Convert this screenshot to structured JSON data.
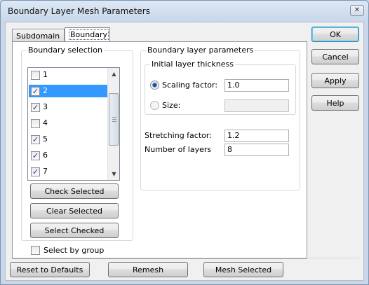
{
  "window": {
    "title": "Boundary Layer Mesh Parameters",
    "close_label": "✕"
  },
  "tabs": [
    {
      "label": "Subdomain",
      "active": false
    },
    {
      "label": "Boundary",
      "active": true
    }
  ],
  "boundary_selection": {
    "title": "Boundary selection",
    "items": [
      {
        "label": "1",
        "checked": false,
        "selected": false
      },
      {
        "label": "2",
        "checked": true,
        "selected": true
      },
      {
        "label": "3",
        "checked": true,
        "selected": false
      },
      {
        "label": "4",
        "checked": false,
        "selected": false
      },
      {
        "label": "5",
        "checked": true,
        "selected": false
      },
      {
        "label": "6",
        "checked": true,
        "selected": false
      },
      {
        "label": "7",
        "checked": true,
        "selected": false
      }
    ],
    "check_selected": "Check Selected",
    "clear_selected": "Clear Selected",
    "select_checked": "Select Checked",
    "select_by_group": "Select by group",
    "select_by_group_checked": false
  },
  "boundary_layer": {
    "title": "Boundary layer parameters",
    "initial_thickness_title": "Initial layer thickness",
    "scaling_factor_label": "Scaling factor:",
    "scaling_factor_value": "1.0",
    "size_label": "Size:",
    "size_value": "",
    "stretching_factor_label": "Stretching factor:",
    "stretching_factor_value": "1.2",
    "num_layers_label": "Number of layers",
    "num_layers_value": "8"
  },
  "side_buttons": {
    "ok": "OK",
    "cancel": "Cancel",
    "apply": "Apply",
    "help": "Help"
  },
  "bottom_buttons": {
    "reset": "Reset to Defaults",
    "remesh": "Remesh",
    "mesh_selected": "Mesh Selected"
  },
  "checkmark": "✓"
}
